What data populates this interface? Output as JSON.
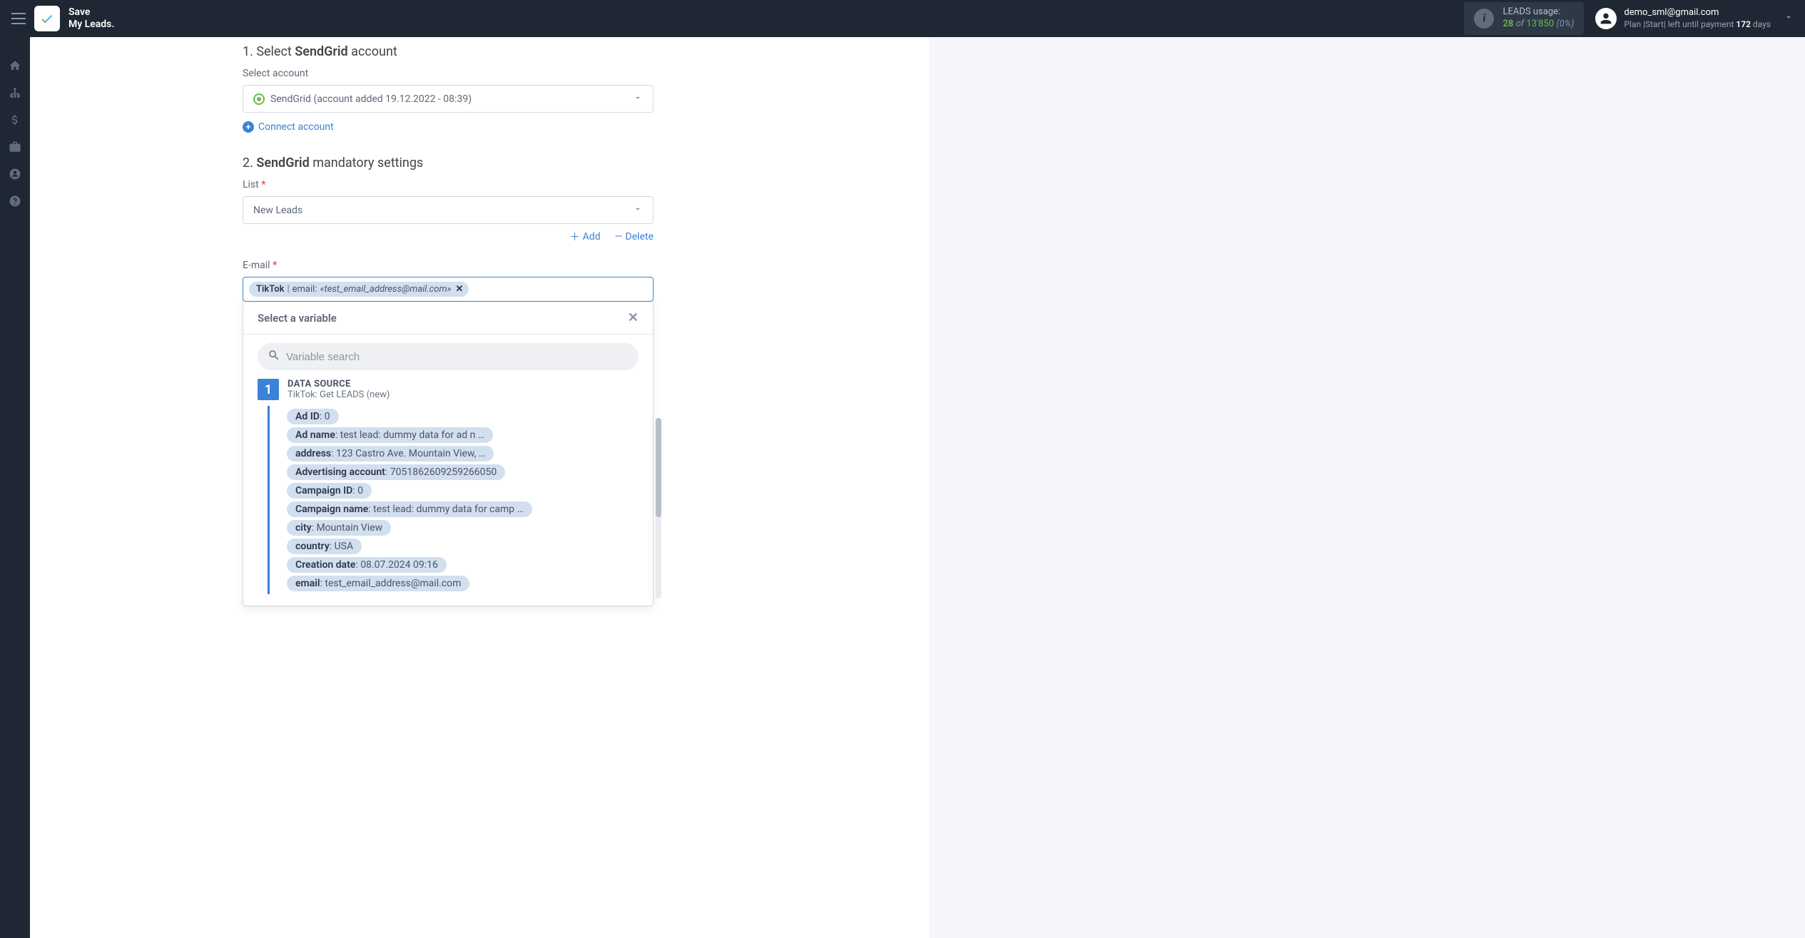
{
  "header": {
    "logo_line1": "Save",
    "logo_line2": "My Leads.",
    "usage_label": "LEADS usage:",
    "usage_current": "28",
    "usage_of": "of",
    "usage_total": "13'850",
    "usage_pct": "(0%)",
    "user_email": "demo_sml@gmail.com",
    "plan_prefix": "Plan |Start| left until payment ",
    "plan_days": "172",
    "plan_suffix": " days"
  },
  "section1": {
    "title_prefix": "1. Select ",
    "title_bold": "SendGrid",
    "title_suffix": " account",
    "field_label": "Select account",
    "selected_account": "SendGrid (account added 19.12.2022 - 08:39)",
    "connect_label": "Connect account"
  },
  "section2": {
    "title_prefix": "2. ",
    "title_bold": "SendGrid",
    "title_suffix": " mandatory settings",
    "list_label": "List",
    "list_value": "New Leads",
    "add_label": "Add",
    "delete_label": "Delete",
    "email_label": "E-mail",
    "tag_source": "TikTok",
    "tag_key": "email:",
    "tag_value": "«test_email_address@mail.com»"
  },
  "dropdown": {
    "title": "Select a variable",
    "search_placeholder": "Variable search",
    "ds_number": "1",
    "ds_title": "DATA SOURCE",
    "ds_sub": "TikTok: Get LEADS (new)",
    "vars": [
      {
        "key": "Ad ID",
        "val": ": 0"
      },
      {
        "key": "Ad name",
        "val": ": test lead: dummy data for ad n …"
      },
      {
        "key": "address",
        "val": ": 123 Castro Ave. Mountain View, …"
      },
      {
        "key": "Advertising account",
        "val": ": 7051862609259266050"
      },
      {
        "key": "Campaign ID",
        "val": ": 0"
      },
      {
        "key": "Campaign name",
        "val": ": test lead: dummy data for camp …"
      },
      {
        "key": "city",
        "val": ": Mountain View"
      },
      {
        "key": "country",
        "val": ": USA"
      },
      {
        "key": "Creation date",
        "val": ": 08.07.2024 09:16"
      },
      {
        "key": "email",
        "val": ": test_email_address@mail.com"
      }
    ]
  }
}
